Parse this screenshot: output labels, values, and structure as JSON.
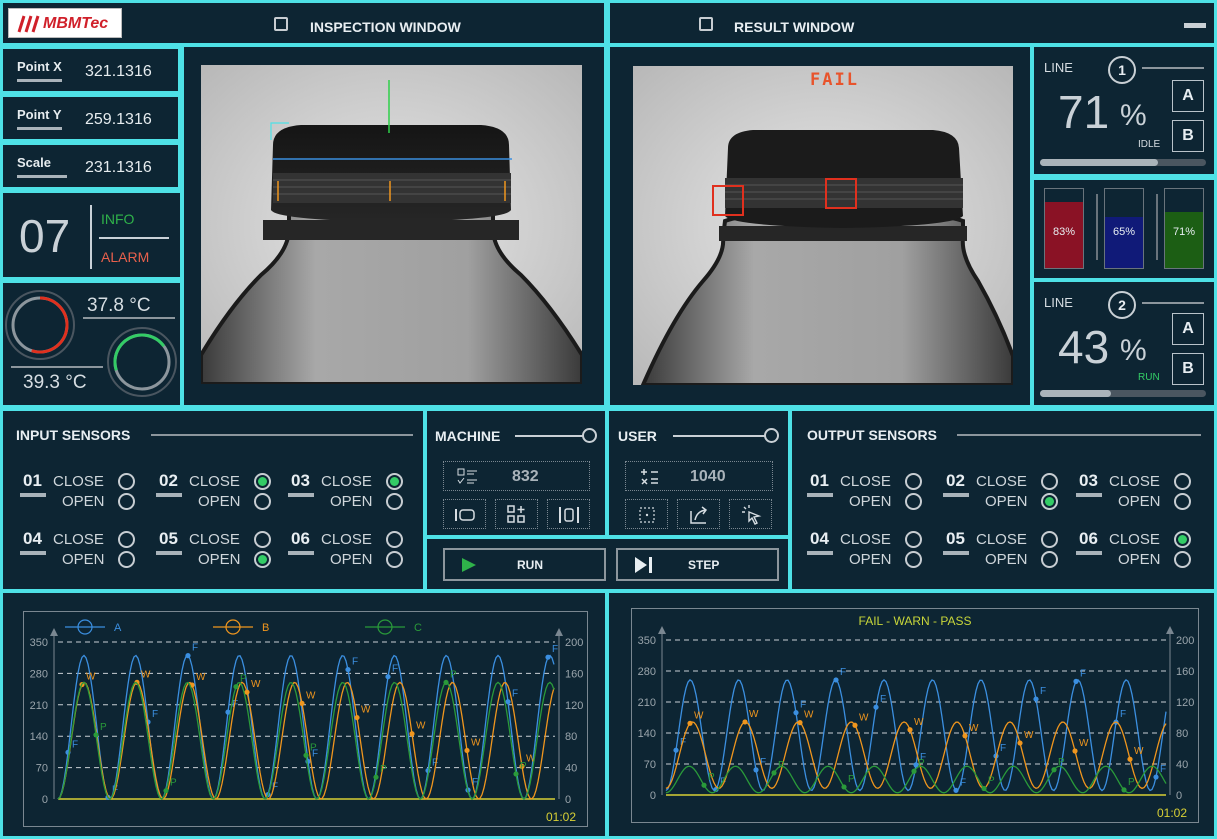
{
  "colors": {
    "accent": "#4ee1e6",
    "fail": "#e0301e",
    "info": "#2fb24a",
    "alarm": "#e8604c",
    "series_a": "#3b8fe0",
    "series_b": "#f0961e",
    "series_c": "#2a9a3a"
  },
  "brand": {
    "logo_text": "MBMTec"
  },
  "header": {
    "inspection_title": "INSPECTION WINDOW",
    "result_title": "RESULT WINDOW"
  },
  "points": {
    "x_label": "Point X",
    "x_value": "321.1316",
    "y_label": "Point Y",
    "y_value": "259.1316",
    "scale_label": "Scale",
    "scale_value": "231.1316"
  },
  "status": {
    "count": "07",
    "info": "INFO",
    "alarm": "ALARM"
  },
  "temps": {
    "t1": "37.8 °C",
    "t2": "39.3 °C",
    "gauge1_level": 0.55,
    "gauge2_level": 0.45
  },
  "result": {
    "verdict": "FAIL"
  },
  "line1": {
    "label": "LINE",
    "number": "1",
    "percent": "71",
    "unit": "%",
    "state": "IDLE",
    "a": "A",
    "b": "B",
    "progress": 0.71
  },
  "line2": {
    "label": "LINE",
    "number": "2",
    "percent": "43",
    "unit": "%",
    "state": "RUN",
    "a": "A",
    "b": "B",
    "progress": 0.43
  },
  "bars": [
    {
      "label": "83%",
      "value": 0.83,
      "color": "#8a1225"
    },
    {
      "label": "65%",
      "value": 0.65,
      "color": "#101a78"
    },
    {
      "label": "71%",
      "value": 0.71,
      "color": "#1c5e14"
    }
  ],
  "input_sensors": {
    "title": "INPUT SENSORS",
    "close": "CLOSE",
    "open": "OPEN",
    "items": [
      {
        "id": "01",
        "state": "none"
      },
      {
        "id": "02",
        "state": "close"
      },
      {
        "id": "03",
        "state": "close"
      },
      {
        "id": "04",
        "state": "none"
      },
      {
        "id": "05",
        "state": "open"
      },
      {
        "id": "06",
        "state": "none"
      }
    ]
  },
  "output_sensors": {
    "title": "OUTPUT SENSORS",
    "close": "CLOSE",
    "open": "OPEN",
    "items": [
      {
        "id": "01",
        "state": "none"
      },
      {
        "id": "02",
        "state": "open"
      },
      {
        "id": "03",
        "state": "none"
      },
      {
        "id": "04",
        "state": "none"
      },
      {
        "id": "05",
        "state": "none"
      },
      {
        "id": "06",
        "state": "close"
      }
    ]
  },
  "machine": {
    "title": "MACHINE",
    "count": "832"
  },
  "user": {
    "title": "USER",
    "count": "1040"
  },
  "controls": {
    "run": "RUN",
    "step": "STEP"
  },
  "chart_data": [
    {
      "type": "line",
      "legend": [
        "A",
        "B",
        "C"
      ],
      "yleft": [
        "0",
        "70",
        "140",
        "210",
        "280",
        "350"
      ],
      "yright": [
        "0",
        "40",
        "80",
        "120",
        "160",
        "200"
      ],
      "ylim": [
        0,
        350
      ],
      "grid": true,
      "time": "01:02",
      "point_labels": {
        "a": "F",
        "b": "W",
        "c": "P"
      },
      "series": [
        {
          "name": "A",
          "amplitude": 160,
          "offset": 160,
          "period": 4
        },
        {
          "name": "B",
          "amplitude": 130,
          "offset": 130,
          "period": 7
        },
        {
          "name": "C",
          "amplitude": 130,
          "offset": 130,
          "period": 8
        }
      ]
    },
    {
      "type": "line",
      "title": "FAIL - WARN - PASS",
      "yleft": [
        "0",
        "70",
        "140",
        "210",
        "280",
        "350"
      ],
      "yright": [
        "0",
        "40",
        "80",
        "120",
        "160",
        "200"
      ],
      "ylim": [
        0,
        350
      ],
      "grid": true,
      "time": "01:02",
      "point_labels": {
        "a": "F",
        "b": "W",
        "c": "P"
      },
      "series": [
        {
          "name": "",
          "amplitude": 125,
          "offset": 135,
          "period": 4.3
        },
        {
          "name": "",
          "amplitude": 75,
          "offset": 90,
          "period": 7
        },
        {
          "name": "",
          "amplitude": 30,
          "offset": 35,
          "period": 9
        }
      ]
    }
  ]
}
